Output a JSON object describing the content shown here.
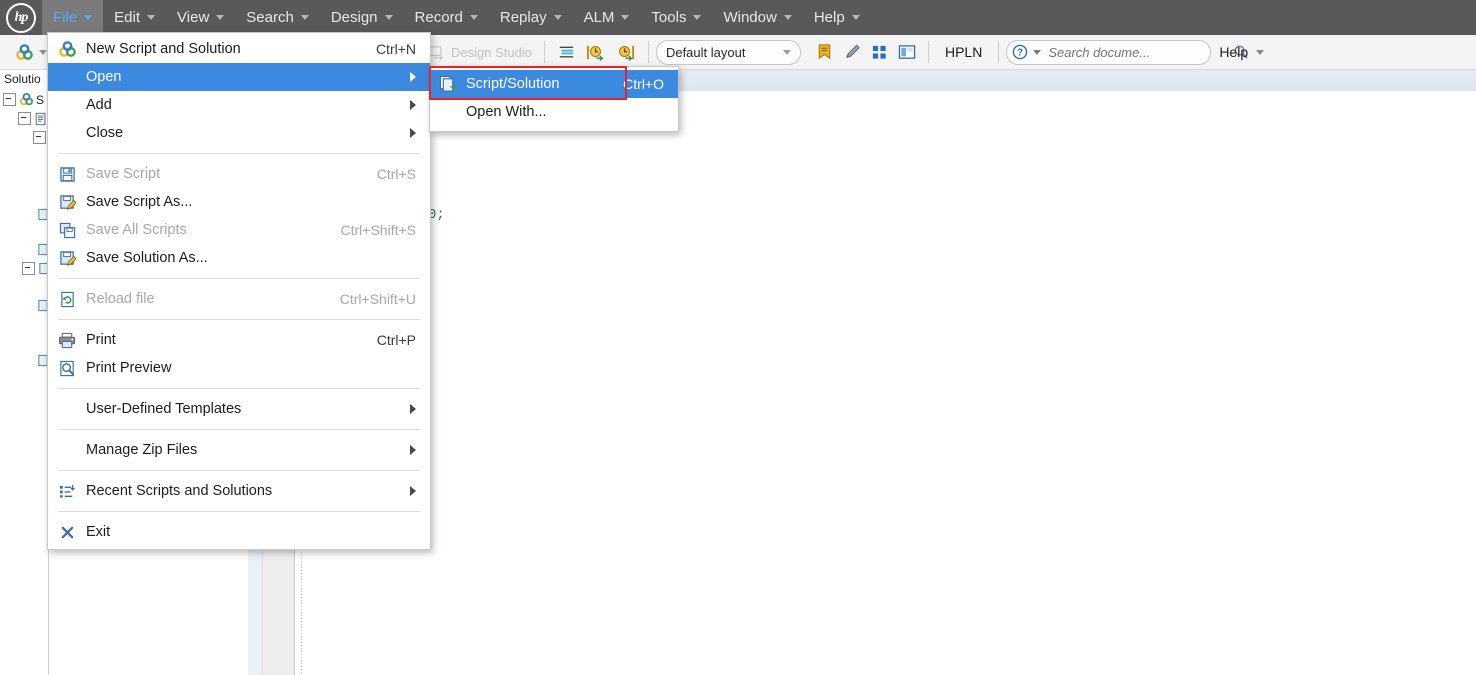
{
  "app": {
    "brand": "hp"
  },
  "menubar": {
    "items": [
      {
        "label": "File",
        "active": true
      },
      {
        "label": "Edit",
        "active": false
      },
      {
        "label": "View",
        "active": false
      },
      {
        "label": "Search",
        "active": false
      },
      {
        "label": "Design",
        "active": false
      },
      {
        "label": "Record",
        "active": false
      },
      {
        "label": "Replay",
        "active": false
      },
      {
        "label": "ALM",
        "active": false
      },
      {
        "label": "Tools",
        "active": false
      },
      {
        "label": "Window",
        "active": false
      },
      {
        "label": "Help",
        "active": false
      }
    ]
  },
  "toolbar": {
    "design_studio_label": "Design Studio",
    "layout_combo_value": "Default layout",
    "hpln_label": "HPLN",
    "help_label": "Help",
    "search": {
      "placeholder": "Search docume...",
      "value": ""
    }
  },
  "sidebar": {
    "title": "Solutio",
    "rows": [
      {
        "text": "S"
      },
      {
        "text": ""
      },
      {
        "text": ""
      },
      {
        "text": ""
      },
      {
        "text": ""
      },
      {
        "text": ""
      }
    ]
  },
  "editor": {
    "code_fragment": "0;"
  },
  "file_menu": {
    "items": [
      {
        "type": "item",
        "label": "New Script and Solution",
        "shortcut": "Ctrl+N",
        "icon": "new-script-solution-icon",
        "disabled": false,
        "submenu": false,
        "highlight": false
      },
      {
        "type": "item",
        "label": "Open",
        "shortcut": "",
        "icon": "",
        "disabled": false,
        "submenu": true,
        "highlight": true
      },
      {
        "type": "item",
        "label": "Add",
        "shortcut": "",
        "icon": "",
        "disabled": false,
        "submenu": true,
        "highlight": false
      },
      {
        "type": "item",
        "label": "Close",
        "shortcut": "",
        "icon": "",
        "disabled": false,
        "submenu": true,
        "highlight": false
      },
      {
        "type": "separator"
      },
      {
        "type": "item",
        "label": "Save Script",
        "shortcut": "Ctrl+S",
        "icon": "save-icon",
        "disabled": true,
        "submenu": false,
        "highlight": false
      },
      {
        "type": "item",
        "label": "Save Script As...",
        "shortcut": "",
        "icon": "save-as-icon",
        "disabled": false,
        "submenu": false,
        "highlight": false
      },
      {
        "type": "item",
        "label": "Save All Scripts",
        "shortcut": "Ctrl+Shift+S",
        "icon": "save-all-icon",
        "disabled": true,
        "submenu": false,
        "highlight": false
      },
      {
        "type": "item",
        "label": "Save Solution As...",
        "shortcut": "",
        "icon": "save-solution-as-icon",
        "disabled": false,
        "submenu": false,
        "highlight": false
      },
      {
        "type": "separator"
      },
      {
        "type": "item",
        "label": "Reload file",
        "shortcut": "Ctrl+Shift+U",
        "icon": "reload-icon",
        "disabled": true,
        "submenu": false,
        "highlight": false
      },
      {
        "type": "separator"
      },
      {
        "type": "item",
        "label": "Print",
        "shortcut": "Ctrl+P",
        "icon": "print-icon",
        "disabled": false,
        "submenu": false,
        "highlight": false
      },
      {
        "type": "item",
        "label": "Print Preview",
        "shortcut": "",
        "icon": "print-preview-icon",
        "disabled": false,
        "submenu": false,
        "highlight": false
      },
      {
        "type": "separator"
      },
      {
        "type": "item",
        "label": "User-Defined Templates",
        "shortcut": "",
        "icon": "",
        "disabled": false,
        "submenu": true,
        "highlight": false
      },
      {
        "type": "separator"
      },
      {
        "type": "item",
        "label": "Manage Zip Files",
        "shortcut": "",
        "icon": "",
        "disabled": false,
        "submenu": true,
        "highlight": false
      },
      {
        "type": "separator"
      },
      {
        "type": "item",
        "label": "Recent Scripts and Solutions",
        "shortcut": "",
        "icon": "recent-list-icon",
        "disabled": false,
        "submenu": true,
        "highlight": false
      },
      {
        "type": "separator"
      },
      {
        "type": "item",
        "label": "Exit",
        "shortcut": "",
        "icon": "exit-icon",
        "disabled": false,
        "submenu": false,
        "highlight": false
      }
    ]
  },
  "open_submenu": {
    "items": [
      {
        "label": "Script/Solution",
        "shortcut": "Ctrl+O",
        "icon": "open-script-solution-icon",
        "highlight": true
      },
      {
        "label": "Open With...",
        "shortcut": "",
        "icon": "",
        "highlight": false
      }
    ]
  },
  "annotation": {
    "color": "#ee2222"
  },
  "colors": {
    "menubar_bg": "#595959",
    "menu_highlight": "#3b8ae0",
    "toolbar_bg": "#f4f4f4",
    "blue_strip": "#e3eaf4",
    "accent_link": "#55aaff"
  }
}
